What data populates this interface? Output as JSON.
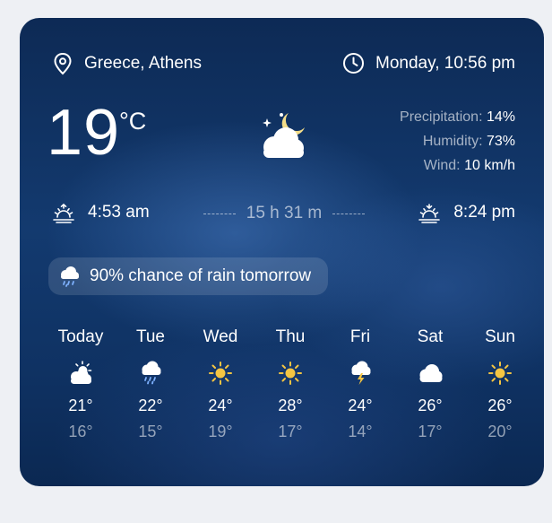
{
  "location": "Greece, Athens",
  "datetime": "Monday, 10:56 pm",
  "current": {
    "temperature": "19",
    "unit": "°C",
    "condition_icon": "partly-cloudy-night-icon"
  },
  "stats": {
    "precipitation_label": "Precipitation:",
    "precipitation_value": "14%",
    "humidity_label": "Humidity:",
    "humidity_value": "73%",
    "wind_label": "Wind:",
    "wind_value": "10 km/h"
  },
  "sun": {
    "sunrise": "4:53 am",
    "day_length": "15 h 31 m",
    "sunset": "8:24 pm"
  },
  "rain_notice": "90% chance of rain tomorrow",
  "forecast": [
    {
      "day": "Today",
      "icon": "partly-cloudy-icon",
      "high": "21°",
      "low": "16°"
    },
    {
      "day": "Tue",
      "icon": "rain-icon",
      "high": "22°",
      "low": "15°"
    },
    {
      "day": "Wed",
      "icon": "sun-icon",
      "high": "24°",
      "low": "19°"
    },
    {
      "day": "Thu",
      "icon": "sun-icon",
      "high": "28°",
      "low": "17°"
    },
    {
      "day": "Fri",
      "icon": "thunderstorm-icon",
      "high": "24°",
      "low": "14°"
    },
    {
      "day": "Sat",
      "icon": "cloud-icon",
      "high": "26°",
      "low": "17°"
    },
    {
      "day": "Sun",
      "icon": "sun-icon",
      "high": "26°",
      "low": "20°"
    }
  ],
  "colors": {
    "card_bg": "#133a6f",
    "sun": "#f5c542",
    "moon": "#f3dd8a",
    "rain": "#7fb2ff"
  }
}
